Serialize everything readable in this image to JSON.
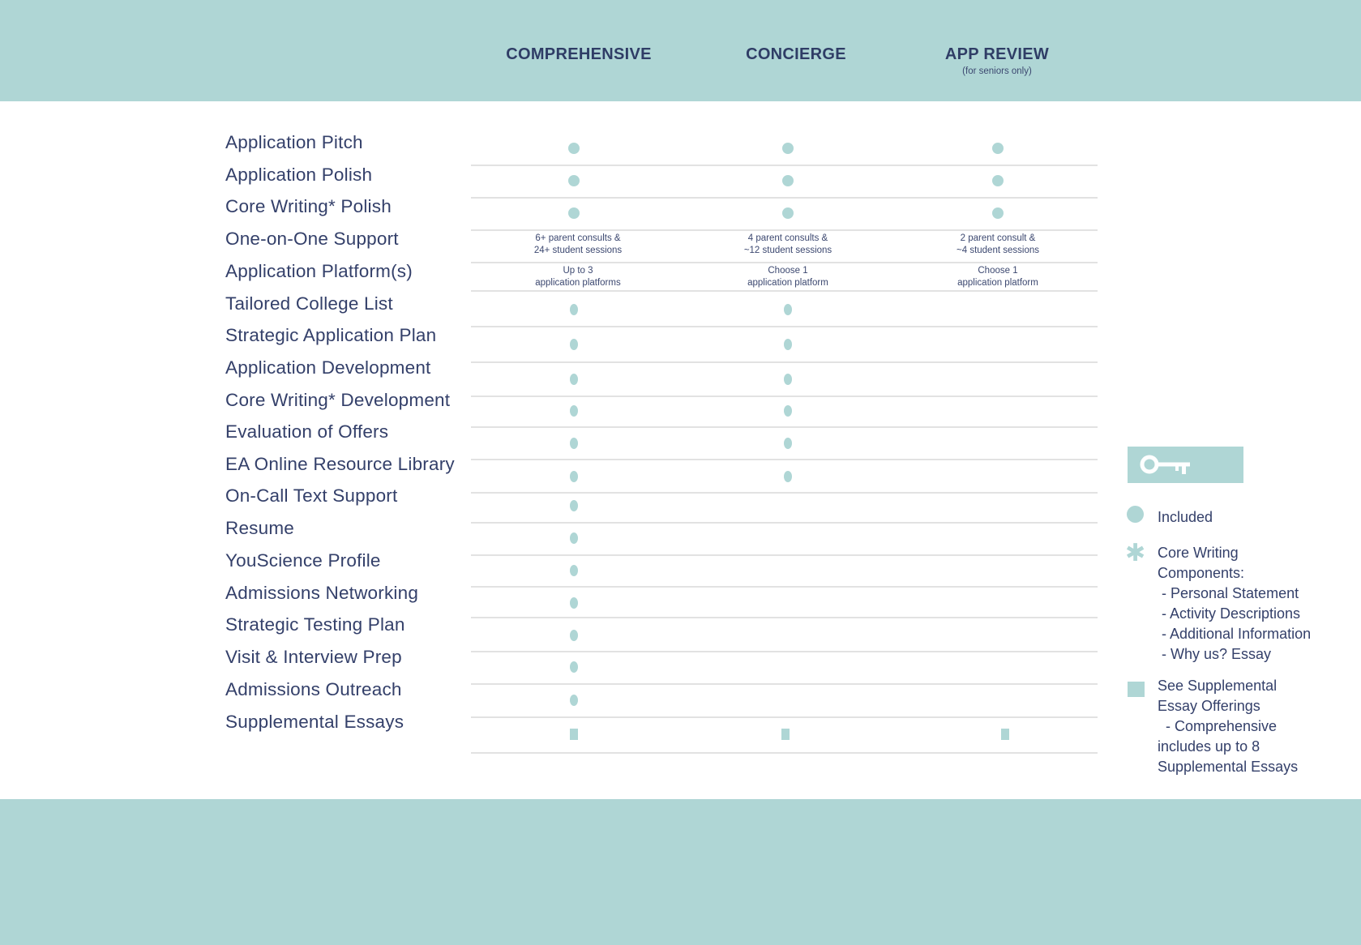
{
  "header": {
    "columns": [
      {
        "title": "COMPREHENSIVE",
        "subtitle": ""
      },
      {
        "title": "CONCIERGE",
        "subtitle": ""
      },
      {
        "title": "APP REVIEW",
        "subtitle": "(for seniors only)"
      }
    ]
  },
  "rows": [
    {
      "label": "Application Pitch",
      "cells": [
        "dot",
        "dot",
        "dot"
      ]
    },
    {
      "label": "Application Polish",
      "cells": [
        "dot",
        "dot",
        "dot"
      ]
    },
    {
      "label": "Core Writing* Polish",
      "cells": [
        "dot",
        "dot",
        "dot"
      ]
    },
    {
      "label": "One-on-One Support",
      "cells": [
        "6+ parent consults &\n24+ student sessions",
        "4 parent consults &\n~12 student sessions",
        "2 parent consult &\n~4 student sessions"
      ]
    },
    {
      "label": "Application Platform(s)",
      "cells": [
        "Up to 3\napplication platforms",
        "Choose 1\napplication platform",
        "Choose 1\napplication platform"
      ]
    },
    {
      "label": "Tailored College List",
      "cells": [
        "dot",
        "dot",
        ""
      ]
    },
    {
      "label": "Strategic Application Plan",
      "cells": [
        "dot",
        "dot",
        ""
      ]
    },
    {
      "label": "Application Development",
      "cells": [
        "dot",
        "dot",
        ""
      ]
    },
    {
      "label": "Core Writing* Development",
      "cells": [
        "dot",
        "dot",
        ""
      ]
    },
    {
      "label": "Evaluation of Offers",
      "cells": [
        "dot",
        "dot",
        ""
      ]
    },
    {
      "label": "EA Online Resource Library",
      "cells": [
        "dot",
        "dot",
        ""
      ]
    },
    {
      "label": "On-Call Text Support",
      "cells": [
        "dot",
        "",
        ""
      ]
    },
    {
      "label": "Resume",
      "cells": [
        "dot",
        "",
        ""
      ]
    },
    {
      "label": "YouScience Profile",
      "cells": [
        "dot",
        "",
        ""
      ]
    },
    {
      "label": "Admissions Networking",
      "cells": [
        "dot",
        "",
        ""
      ]
    },
    {
      "label": "Strategic Testing Plan",
      "cells": [
        "dot",
        "",
        ""
      ]
    },
    {
      "label": "Visit & Interview Prep",
      "cells": [
        "dot",
        "",
        ""
      ]
    },
    {
      "label": "Admissions Outreach",
      "cells": [
        "dot",
        "",
        ""
      ]
    },
    {
      "label": "Supplemental Essays",
      "cells": [
        "square",
        "square",
        "square"
      ]
    }
  ],
  "legend": {
    "key_icon": "key-icon",
    "items": [
      {
        "symbol": "circle",
        "text": "Included"
      },
      {
        "symbol": "asterisk",
        "text": "Core Writing\nComponents:\n - Personal Statement\n - Activity Descriptions\n - Additional Information\n - Why us? Essay"
      },
      {
        "symbol": "square",
        "text": "See Supplemental\nEssay Offerings\n  - Comprehensive\nincludes up to 8\nSupplemental Essays"
      }
    ]
  },
  "colors": {
    "accent": "#afd6d5",
    "text": "#34406a",
    "divider": "#e2e2e2"
  }
}
